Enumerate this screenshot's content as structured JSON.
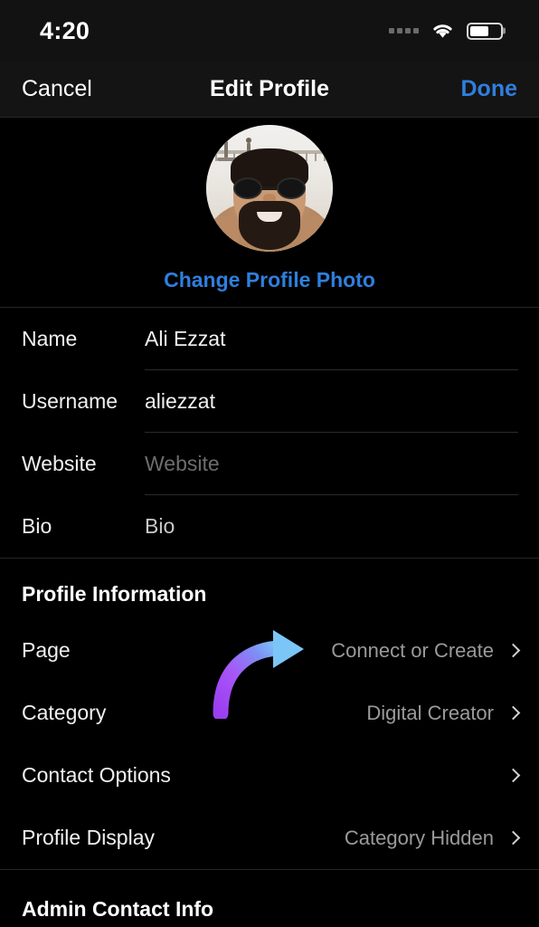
{
  "status_bar": {
    "time": "4:20",
    "signal_icon": "signal-dots-icon",
    "wifi_icon": "wifi-icon",
    "battery_icon": "battery-icon",
    "battery_level_percent": 62
  },
  "nav_bar": {
    "cancel_label": "Cancel",
    "title": "Edit Profile",
    "done_label": "Done",
    "done_color": "#2f7fdd"
  },
  "photo_section": {
    "avatar_alt": "profile-photo",
    "change_photo_label": "Change Profile Photo",
    "link_color": "#2f7fdd"
  },
  "form": {
    "fields": [
      {
        "label": "Name",
        "value": "Ali Ezzat",
        "style": "value"
      },
      {
        "label": "Username",
        "value": "aliezzat",
        "style": "value"
      },
      {
        "label": "Website",
        "value": "Website",
        "style": "placeholder"
      },
      {
        "label": "Bio",
        "value": "Bio",
        "style": "muted"
      }
    ]
  },
  "profile_information": {
    "title": "Profile Information",
    "rows": [
      {
        "label": "Page",
        "value": "Connect or Create",
        "chevron": "chevron-right-icon"
      },
      {
        "label": "Category",
        "value": "Digital Creator",
        "chevron": "chevron-right-icon"
      },
      {
        "label": "Contact Options",
        "value": "",
        "chevron": "chevron-right-icon"
      },
      {
        "label": "Profile Display",
        "value": "Category Hidden",
        "chevron": "chevron-right-icon"
      }
    ]
  },
  "admin_contact_info": {
    "title": "Admin Contact Info"
  },
  "annotation": {
    "type": "curved-arrow",
    "points_to": "Page row value",
    "gradient_start": "#a855f7",
    "gradient_end": "#7cc6f7"
  }
}
